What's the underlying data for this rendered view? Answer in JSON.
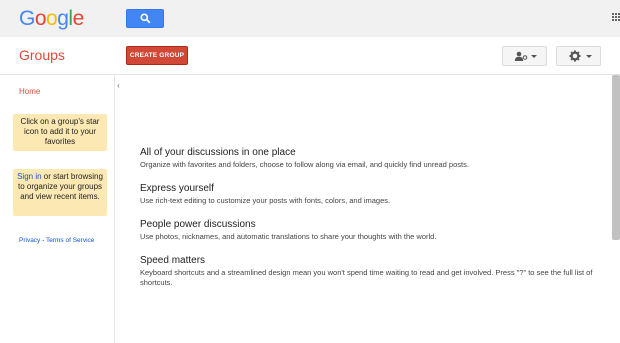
{
  "header": {
    "logo_letters": [
      {
        "char": "G",
        "color": "#4285f4"
      },
      {
        "char": "o",
        "color": "#ea4335"
      },
      {
        "char": "o",
        "color": "#fbbc05"
      },
      {
        "char": "g",
        "color": "#4285f4"
      },
      {
        "char": "l",
        "color": "#34a853"
      },
      {
        "char": "e",
        "color": "#ea4335"
      }
    ],
    "search_icon": "search-icon",
    "apps_icon": "apps-grid-icon"
  },
  "toolbar": {
    "title": "Groups",
    "create_label": "CREATE GROUP",
    "person_icon": "person-settings-icon",
    "gear_icon": "gear-icon"
  },
  "sidebar": {
    "home_label": "Home",
    "tip1": "Click on a group's star icon to add it to your favorites",
    "tip2_link": "Sign in",
    "tip2_rest": " or start browsing to organize your groups and view recent items.",
    "privacy_label": "Privacy",
    "separator": " - ",
    "terms_label": "Terms of Service",
    "collapse_glyph": "‹"
  },
  "main": {
    "features": [
      {
        "title": "All of your discussions in one place",
        "desc": "Organize with favorites and folders, choose to follow along via email, and quickly find unread posts."
      },
      {
        "title": "Express yourself",
        "desc": "Use rich-text editing to customize your posts with fonts, colors, and images."
      },
      {
        "title": "People power discussions",
        "desc": "Use photos, nicknames, and automatic translations to share your thoughts with the world."
      },
      {
        "title": "Speed matters",
        "desc": "Keyboard shortcuts and a streamlined design mean you won't spend time waiting to read and get involved. Press \"?\" to see the full list of shortcuts."
      }
    ]
  },
  "colors": {
    "brand_red": "#dd4b39",
    "search_blue": "#4285f4",
    "tip_yellow": "#fce8b2",
    "link_blue": "#1155cc"
  }
}
